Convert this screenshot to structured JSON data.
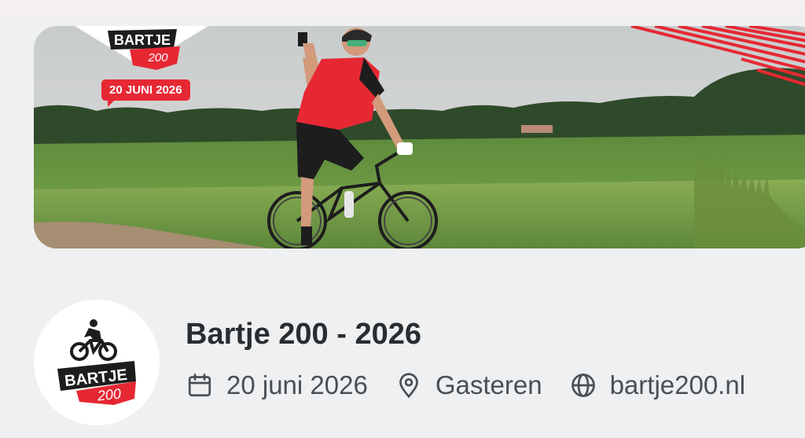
{
  "event": {
    "title": "Bartje 200 - 2026",
    "date": "20 juni 2026",
    "location": "Gasteren",
    "website": "bartje200.nl"
  },
  "banner": {
    "logo_text": "BARTJE",
    "logo_number": "200",
    "date_label": "20 JUNI 2026"
  },
  "avatar": {
    "logo_text": "BARTJE",
    "logo_number": "200"
  },
  "icons": {
    "date": "calendar-icon",
    "location": "map-pin-icon",
    "website": "globe-icon"
  },
  "colors": {
    "brand_red": "#e62833",
    "title_text": "#2a2d30",
    "meta_text": "#4a4f55",
    "background": "#eef0f1"
  }
}
